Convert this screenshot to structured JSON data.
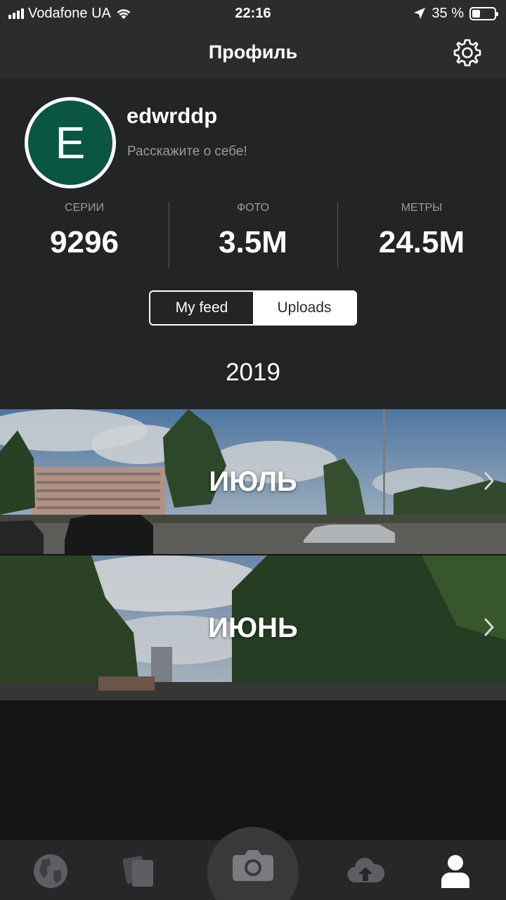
{
  "status_bar": {
    "carrier": "Vodafone UA",
    "time": "22:16",
    "battery": "35 %",
    "battery_level": 0.35
  },
  "nav": {
    "title": "Профиль"
  },
  "profile": {
    "avatar_letter": "E",
    "avatar_color": "#0b5643",
    "username": "edwrddp",
    "bio_placeholder": "Расскажите о себе!"
  },
  "stats": [
    {
      "label": "СЕРИИ",
      "value": "9296"
    },
    {
      "label": "ФОТО",
      "value": "3.5M"
    },
    {
      "label": "МЕТРЫ",
      "value": "24.5M"
    }
  ],
  "segments": {
    "my_feed": "My feed",
    "uploads": "Uploads",
    "selected": "Uploads"
  },
  "feed": {
    "year": "2019",
    "months": [
      {
        "label": "ИЮЛЬ"
      },
      {
        "label": "ИЮНЬ"
      }
    ]
  },
  "tab_bar": {
    "items": [
      {
        "icon": "globe-icon"
      },
      {
        "icon": "cards-icon"
      },
      {
        "icon": "camera-icon"
      },
      {
        "icon": "cloud-upload-icon"
      },
      {
        "icon": "user-icon",
        "active": true
      }
    ]
  }
}
